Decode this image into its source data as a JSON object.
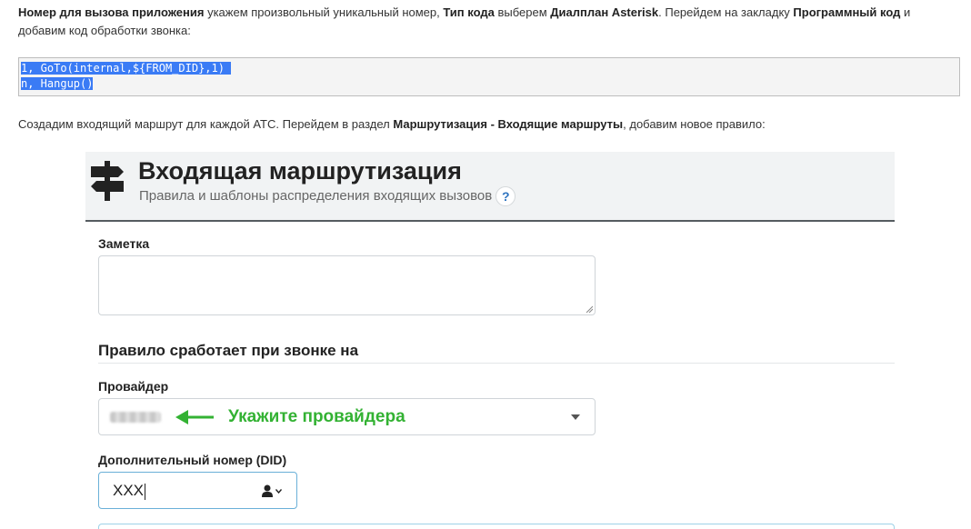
{
  "intro": {
    "p1_b1": "Номер для вызова приложения",
    "p1_t1": " укажем произвольный уникальный номер, ",
    "p1_b2": "Тип кода",
    "p1_t2": " выберем ",
    "p1_b3": "Диалплан Asterisk",
    "p1_t3": ". Перейдем на закладку ",
    "p1_b4": "Программный код",
    "p1_t4": " и добавим код обработки звонка:"
  },
  "code": {
    "line1": "1, GoTo(internal,${FROM_DID},1) ",
    "line2": "n, Hangup()"
  },
  "routing_intro": {
    "t1": "Создадим входящий маршрут для каждой АТС. Перейдем в раздел ",
    "b1": "Маршрутизация - Входящие маршруты",
    "t2": ", добавим новое правило:"
  },
  "panel": {
    "title": "Входящая маршрутизация",
    "subtitle": "Правила и шаблоны распределения входящих вызовов",
    "help": "?"
  },
  "form": {
    "note_label": "Заметка",
    "section_heading": "Правило сработает при звонке на",
    "provider_label": "Провайдер",
    "provider_hint": "Укажите провайдера",
    "did_label": "Дополнительный номер (DID)",
    "did_value": "XXX"
  },
  "colors": {
    "hint_green": "#33b233",
    "selection_blue": "#3a7bf5"
  },
  "icons": {
    "header": "signpost-icon",
    "help": "question-icon",
    "hint_arrow": "arrow-left-icon",
    "select": "caret-down-icon",
    "did_picker": "user-icon"
  }
}
